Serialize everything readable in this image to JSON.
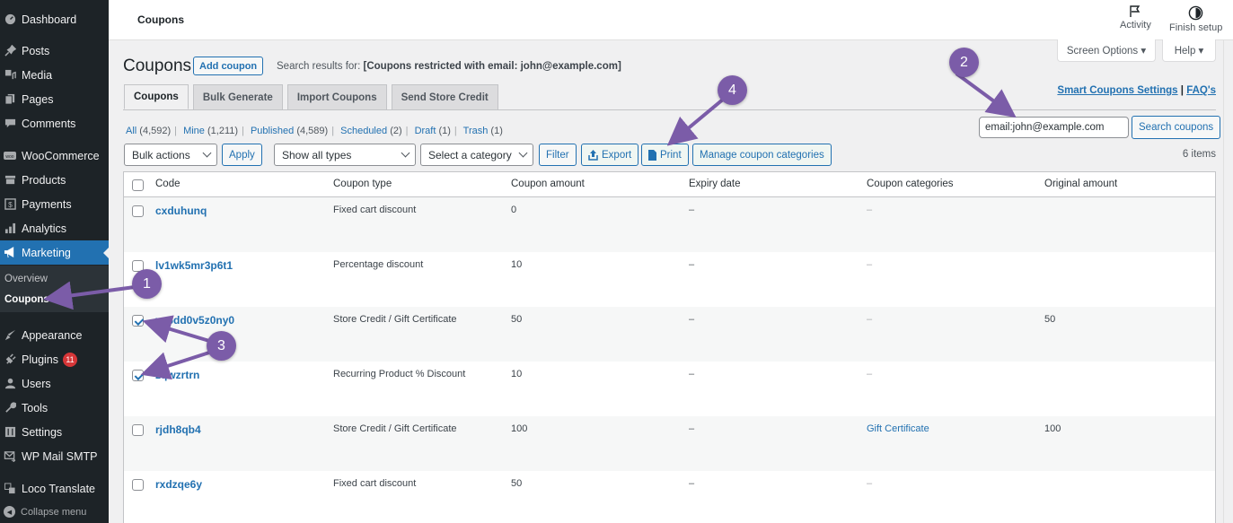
{
  "sidebar": {
    "items": [
      {
        "label": "Dashboard",
        "icon": "dashboard-icon"
      },
      {
        "label": "Posts",
        "icon": "pin-icon"
      },
      {
        "label": "Media",
        "icon": "media-icon"
      },
      {
        "label": "Pages",
        "icon": "pages-icon"
      },
      {
        "label": "Comments",
        "icon": "comment-icon"
      },
      {
        "label": "WooCommerce",
        "icon": "woocommerce-icon"
      },
      {
        "label": "Products",
        "icon": "archive-icon"
      },
      {
        "label": "Payments",
        "icon": "payments-icon"
      },
      {
        "label": "Analytics",
        "icon": "bar-chart-icon"
      },
      {
        "label": "Marketing",
        "icon": "megaphone-icon"
      },
      {
        "label": "Appearance",
        "icon": "brush-icon"
      },
      {
        "label": "Plugins",
        "icon": "plugin-icon",
        "badge": "11"
      },
      {
        "label": "Users",
        "icon": "user-icon"
      },
      {
        "label": "Tools",
        "icon": "wrench-icon"
      },
      {
        "label": "Settings",
        "icon": "settings-icon"
      },
      {
        "label": "WP Mail SMTP",
        "icon": "mail-icon"
      },
      {
        "label": "Loco Translate",
        "icon": "translate-icon"
      }
    ],
    "submenu": [
      {
        "label": "Overview"
      },
      {
        "label": "Coupons"
      }
    ],
    "collapse_label": "Collapse menu"
  },
  "topbar": {
    "breadcrumb": "Coupons",
    "activity_label": "Activity",
    "finish_setup_label": "Finish setup"
  },
  "screen_options_label": "Screen Options ▾",
  "help_label": "Help ▾",
  "header": {
    "title": "Coupons",
    "add_button": "Add coupon",
    "search_results_prefix": "Search results for: ",
    "search_results_query": "[Coupons restricted with email: john@example.com]"
  },
  "tabs": [
    {
      "label": "Coupons",
      "active": true
    },
    {
      "label": "Bulk Generate"
    },
    {
      "label": "Import Coupons"
    },
    {
      "label": "Send Store Credit"
    }
  ],
  "links": {
    "settings": "Smart Coupons Settings",
    "separator": "|",
    "faq": "FAQ's"
  },
  "filters": [
    {
      "label": "All",
      "count": "(4,592)"
    },
    {
      "label": "Mine",
      "count": "(1,211)"
    },
    {
      "label": "Published",
      "count": "(4,589)"
    },
    {
      "label": "Scheduled",
      "count": "(2)"
    },
    {
      "label": "Draft",
      "count": "(1)"
    },
    {
      "label": "Trash",
      "count": "(1)"
    }
  ],
  "search": {
    "value": "email:john@example.com",
    "button": "Search coupons"
  },
  "items_count": "6 items",
  "tablenav": {
    "bulk_actions": "Bulk actions",
    "apply": "Apply",
    "type_filter": "Show all types",
    "category_filter": "Select a category",
    "filter": "Filter",
    "export": "Export",
    "print": "Print",
    "manage_categories": "Manage coupon categories"
  },
  "table": {
    "columns": [
      "Code",
      "Coupon type",
      "Coupon amount",
      "Expiry date",
      "Coupon categories",
      "Original amount"
    ],
    "rows": [
      {
        "checked": false,
        "code": "cxduhunq",
        "type": "Fixed cart discount",
        "amount": "0",
        "expiry": "–",
        "categories": "–",
        "original": ""
      },
      {
        "checked": false,
        "code": "lv1wk5mr3p6t1",
        "type": "Percentage discount",
        "amount": "10",
        "expiry": "–",
        "categories": "–",
        "original": ""
      },
      {
        "checked": true,
        "code": "xc6dd0v5z0ny0",
        "type": "Store Credit / Gift Certificate",
        "amount": "50",
        "expiry": "–",
        "categories": "–",
        "original": "50"
      },
      {
        "checked": true,
        "code": "zqwzrtrn",
        "type": "Recurring Product % Discount",
        "amount": "10",
        "expiry": "–",
        "categories": "–",
        "original": ""
      },
      {
        "checked": false,
        "code": "rjdh8qb4",
        "type": "Store Credit / Gift Certificate",
        "amount": "100",
        "expiry": "–",
        "categories": "Gift Certificate",
        "categories_link": true,
        "original": "100"
      },
      {
        "checked": false,
        "code": "rxdzqe6y",
        "type": "Fixed cart discount",
        "amount": "50",
        "expiry": "–",
        "categories": "–",
        "original": ""
      }
    ]
  },
  "annotations": [
    {
      "label": "1"
    },
    {
      "label": "2"
    },
    {
      "label": "3"
    },
    {
      "label": "4"
    }
  ],
  "colors": {
    "accent": "#2271b1",
    "sidebar_bg": "#1d2327",
    "annotation": "#7b5ca8",
    "badge": "#d63638"
  }
}
